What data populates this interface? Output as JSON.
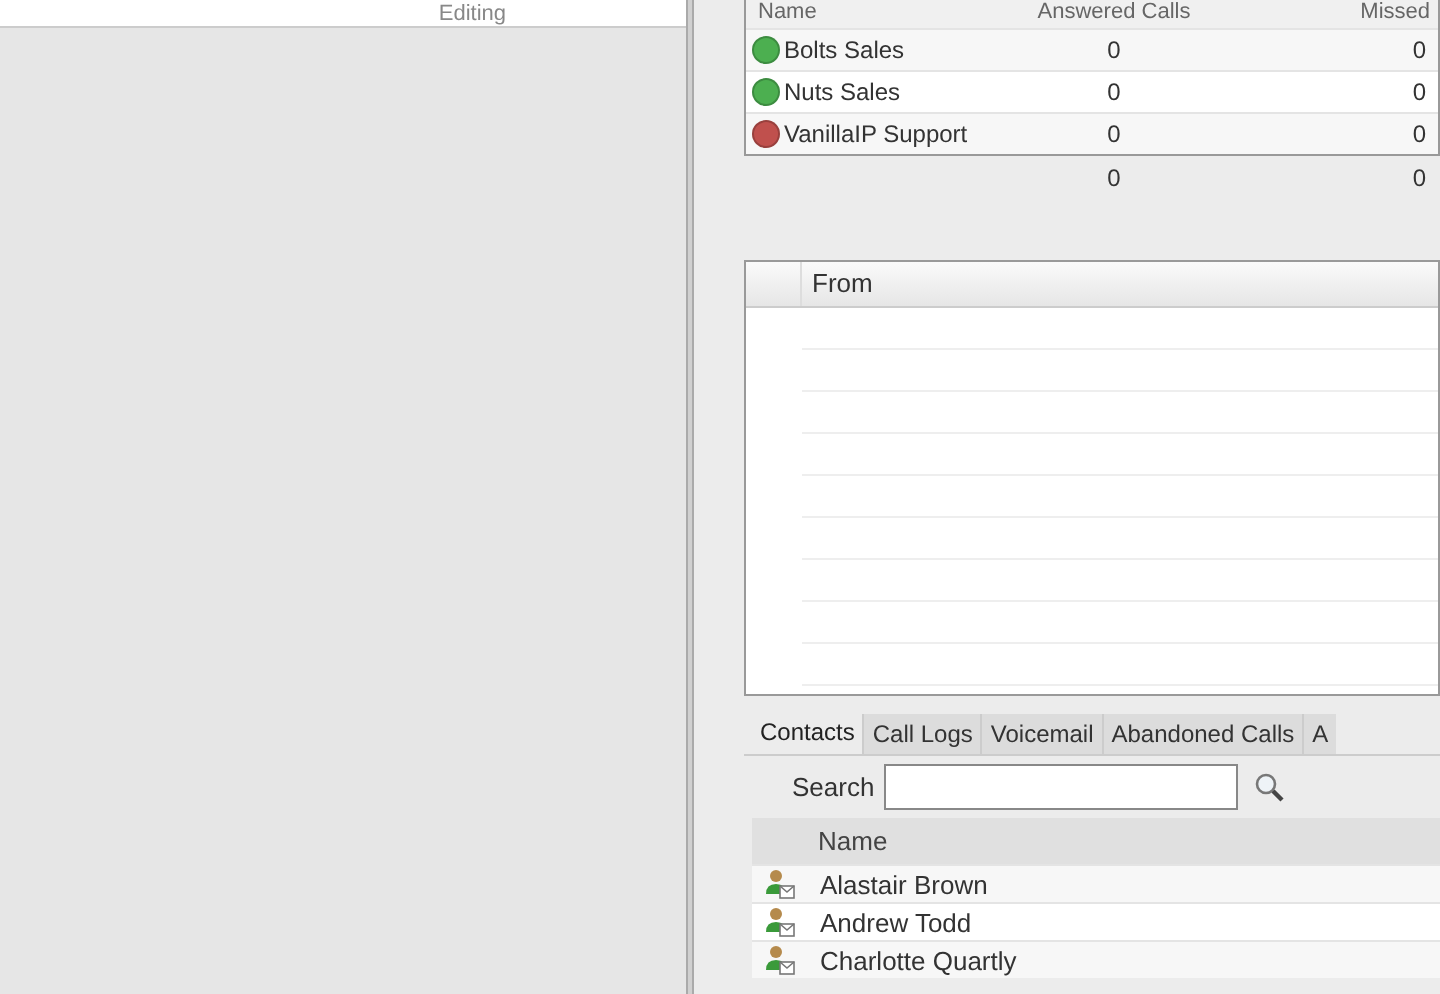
{
  "left_toolbar": {
    "label": "Editing"
  },
  "queues": {
    "columns": [
      "Name",
      "Answered Calls",
      "Missed"
    ],
    "rows": [
      {
        "name": "Bolts Sales",
        "color": "#4caf50",
        "answered": "0",
        "missed": "0"
      },
      {
        "name": "Nuts Sales",
        "color": "#4caf50",
        "answered": "0",
        "missed": "0"
      },
      {
        "name": "VanillaIP Support",
        "color": "#c0504d",
        "answered": "0",
        "missed": "0"
      }
    ],
    "totals": {
      "answered": "0",
      "missed": "0"
    }
  },
  "calls": {
    "columns": [
      "From"
    ]
  },
  "tabs": [
    {
      "label": "Contacts",
      "selected": true
    },
    {
      "label": "Call Logs",
      "selected": false
    },
    {
      "label": "Voicemail",
      "selected": false
    },
    {
      "label": "Abandoned Calls",
      "selected": false
    },
    {
      "label": "A",
      "selected": false
    }
  ],
  "search": {
    "label": "Search"
  },
  "contacts": {
    "columns": [
      "Name"
    ],
    "rows": [
      {
        "name": "Alastair Brown"
      },
      {
        "name": "Andrew Todd"
      },
      {
        "name": "Charlotte Quartly"
      }
    ]
  }
}
